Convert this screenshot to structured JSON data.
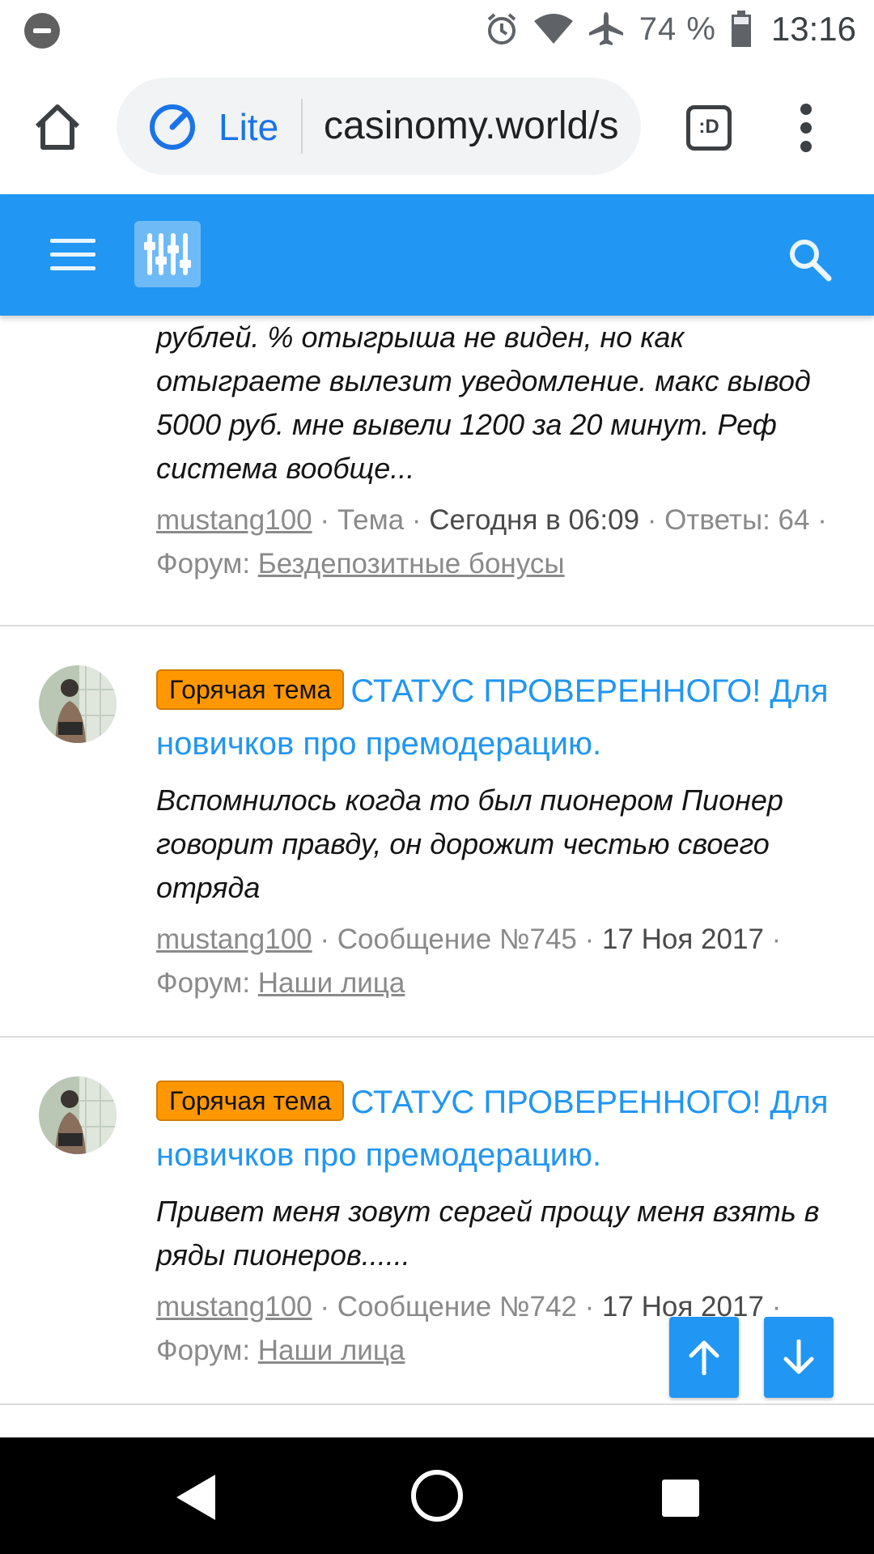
{
  "status_bar": {
    "battery": "74 %",
    "time": "13:16",
    "icons": [
      "do-not-disturb-icon",
      "alarm-icon",
      "wifi-icon",
      "airplane-icon",
      "battery-icon"
    ]
  },
  "browser": {
    "lite_label": "Lite",
    "url": "casinomy.world/s",
    "tab_icon_label": ":D",
    "icons": [
      "home-icon",
      "lite-speed-icon",
      "tab-switcher-icon",
      "more-vert-icon"
    ]
  },
  "site_header": {
    "color": "#2196f3",
    "icons": [
      "hamburger-menu-icon",
      "filter-icon",
      "search-icon"
    ]
  },
  "first_result": {
    "snippet": "рублей. % отыгрыша не виден, но как отыграете вылезит уведомление. макс вывод 5000 руб. мне вывели 1200 за 20 минут. Реф система вообще...",
    "author": "mustang100",
    "sep1": " · ",
    "type": "Тема",
    "sep2": " · ",
    "date": "Сегодня в 06:09",
    "replies": " · Ответы: 64 · Форум: ",
    "forum": "Бездепозитные бонусы"
  },
  "results": [
    {
      "badge": "Горячая тема",
      "title": "СТАТУС ПРОВЕРЕННОГО! Для новичков про премодерацию.",
      "snippet": "Вспомнилось когда то был пионером Пионер говорит правду, он дорожит честью своего отряда",
      "author": "mustang100",
      "post": " · Сообщение №745 · ",
      "date": "17 Ноя 2017",
      "forum_label": " · Форум: ",
      "forum": "Наши лица"
    },
    {
      "badge": "Горячая тема",
      "title": "СТАТУС ПРОВЕРЕННОГО! Для новичков про премодерацию.",
      "snippet": "Привет меня зовут сергей прощу меня взять в ряды пионеров......",
      "author": "mustang100",
      "post": " · Сообщение №742 · ",
      "date": "17 Ноя 2017",
      "forum_label": " · Форум: ",
      "forum": "Наши лица"
    }
  ],
  "fab": {
    "icons": [
      "arrow-up-icon",
      "arrow-down-icon"
    ]
  },
  "nav_bar": {
    "icons": [
      "back-icon",
      "home-circle-icon",
      "recents-icon"
    ]
  }
}
